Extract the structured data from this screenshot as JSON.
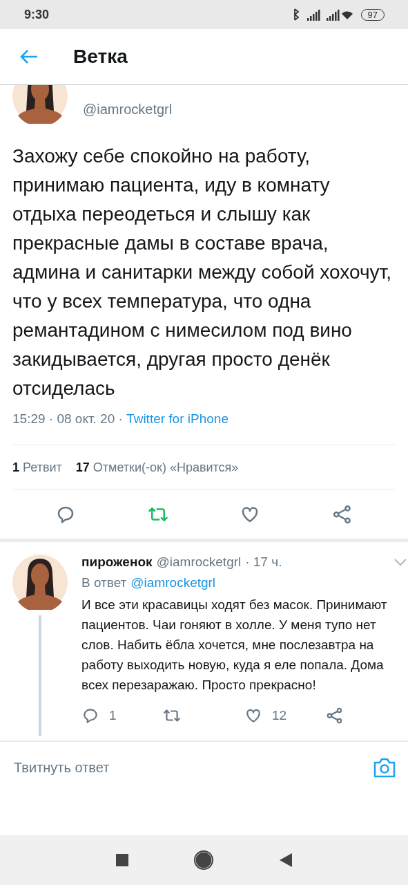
{
  "status_bar": {
    "time": "9:30",
    "battery": "97"
  },
  "header": {
    "title": "Ветка"
  },
  "tweet": {
    "handle": "@iamrocketgrl",
    "text": "Захожу себе спокойно на работу, принимаю пациента, иду в комнату отдыха переодеться и слышу как прекрасные дамы в составе врача, админа и санитарки между собой хохочут, что у всех температура, что одна ремантадином с нимесилом под вино закидывается, другая просто денёк отсиделась",
    "date": "15:29 · 08 окт. 20 · ",
    "source": "Twitter for iPhone",
    "stats": [
      {
        "count": "1",
        "label": "Ретвит"
      },
      {
        "count": "17",
        "label": "Отметки(-ок) «Нравится»"
      }
    ],
    "retweeted": true,
    "liked": false
  },
  "reply": {
    "name": "пироженок",
    "handle": "@iamrocketgrl",
    "time": "· 17 ч.",
    "reply_prefix": "В ответ",
    "reply_to": "@iamrocketgrl",
    "text": "И все эти красавицы ходят без масок. Принимают пациентов. Чаи гоняют в холле. У меня тупо нет слов. Набить ёбла хочется, мне послезавтра на работу выходить новую, куда я еле попала. Дома всех перезаражаю. Просто прекрасно!",
    "actions": [
      {
        "kind": "reply",
        "count": "1"
      },
      {
        "kind": "retweet"
      },
      {
        "kind": "like",
        "count": "12"
      },
      {
        "kind": "share"
      }
    ]
  },
  "compose": {
    "placeholder": "Твитнуть ответ"
  }
}
